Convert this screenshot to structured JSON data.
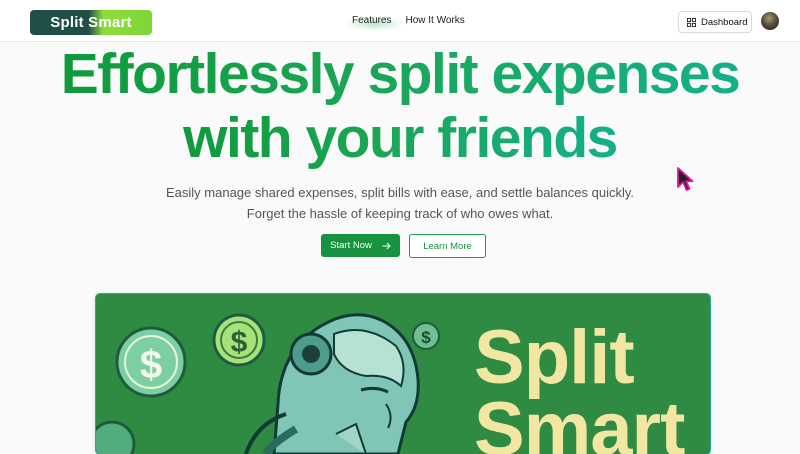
{
  "header": {
    "logo_text": "Split Smart",
    "nav": {
      "features": "Features",
      "how_it_works": "How It Works"
    },
    "dashboard_label": "Dashboard"
  },
  "hero": {
    "title_line1": "Effortlessly split expenses",
    "title_line2": "with your friends",
    "subtitle": "Easily manage shared expenses, split bills with ease, and settle balances quickly. Forget the hassle of keeping track of who owes what.",
    "start_label": "Start Now",
    "learn_label": "Learn More"
  },
  "banner": {
    "text_line1": "Split",
    "text_line2": "Smart"
  },
  "icons": {
    "dashboard": "grid-icon",
    "start": "arrow-right-icon",
    "coin": "dollar-coin-icon",
    "cursor": "mouse-pointer-icon"
  },
  "colors": {
    "brand_green": "#17923f",
    "title_green": "#19a04c",
    "banner_bg": "#2f8a42",
    "banner_text": "#f2e7a2",
    "cursor": "#c5128f"
  }
}
